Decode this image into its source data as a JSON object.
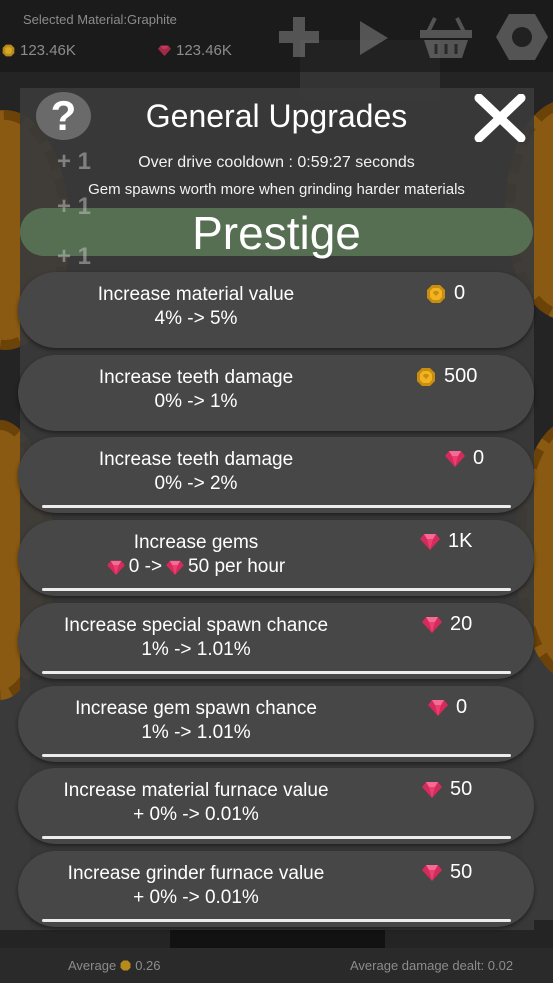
{
  "hud": {
    "selected_material": "Selected Material:Graphite",
    "coins": "123.46K",
    "gems": "123.46K"
  },
  "footer": {
    "average_label": "Average",
    "average_value": "0.26",
    "damage": "Average damage dealt: 0.02"
  },
  "dialog": {
    "title": "General Upgrades",
    "help": "?",
    "cooldown": "Over drive cooldown : 0:59:27 seconds",
    "hint": "Gem spawns worth more when grinding harder materials",
    "prestige": "Prestige",
    "plus_labels": [
      "+ 1",
      "+ 1",
      "+ 1"
    ]
  },
  "upgrades": [
    {
      "title": "Increase material value",
      "value": "4% -> 5%",
      "cost": "0",
      "currency": "coin",
      "progress": null
    },
    {
      "title": "Increase teeth damage",
      "value": "0% -> 1%",
      "cost": "500",
      "currency": "coin",
      "progress": null
    },
    {
      "title": "Increase teeth damage",
      "value": "0% -> 2%",
      "cost": "0",
      "currency": "gem",
      "progress": 1
    },
    {
      "title": "Increase gems",
      "value_from": "0 ->",
      "value_to": "50 per hour",
      "cost": "1K",
      "currency": "gem",
      "progress": 1
    },
    {
      "title": "Increase special spawn chance",
      "value": "1% -> 1.01%",
      "cost": "20",
      "currency": "gem",
      "progress": 1
    },
    {
      "title": "Increase gem spawn chance",
      "value": "1% -> 1.01%",
      "cost": "0",
      "currency": "gem",
      "progress": 1
    },
    {
      "title": "Increase material furnace value",
      "value": "+ 0% -> 0.01%",
      "cost": "50",
      "currency": "gem",
      "progress": 1
    },
    {
      "title": "Increase grinder furnace value",
      "value": "+ 0% -> 0.01%",
      "cost": "50",
      "currency": "gem",
      "progress": 1
    }
  ],
  "colors": {
    "panel": "#3a3a3a",
    "card": "#474747",
    "prestige": "#566f52",
    "gem": "#e8356a",
    "coin": "#e9a21b"
  }
}
